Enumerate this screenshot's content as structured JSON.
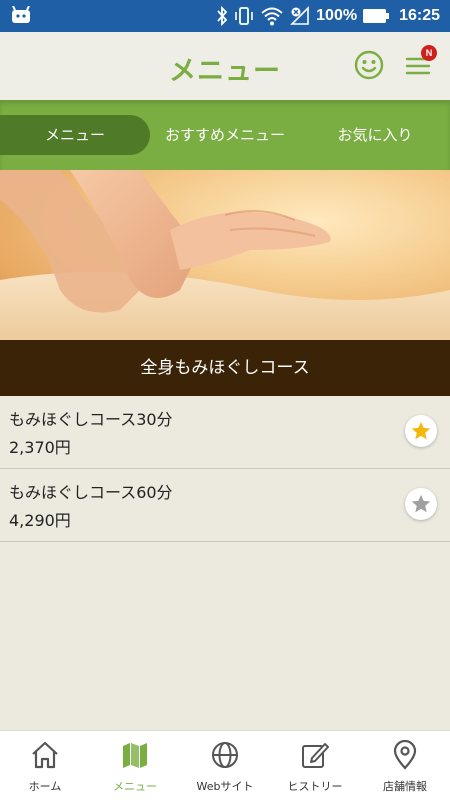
{
  "statusbar": {
    "battery": "100%",
    "time": "16:25"
  },
  "header": {
    "title": "メニュー",
    "badge": "N"
  },
  "tabs": [
    {
      "label": "メニュー",
      "active": true
    },
    {
      "label": "おすすめメニュー",
      "active": false
    },
    {
      "label": "お気に入り",
      "active": false
    }
  ],
  "category": {
    "title": "全身もみほぐしコース"
  },
  "items": [
    {
      "name": "もみほぐしコース30分",
      "price": "2,370円",
      "favorite": true
    },
    {
      "name": "もみほぐしコース60分",
      "price": "4,290円",
      "favorite": false
    }
  ],
  "nav": [
    {
      "label": "ホーム",
      "icon": "home-icon"
    },
    {
      "label": "メニュー",
      "icon": "map-icon",
      "active": true
    },
    {
      "label": "Webサイト",
      "icon": "globe-icon"
    },
    {
      "label": "ヒストリー",
      "icon": "edit-icon"
    },
    {
      "label": "店舗情報",
      "icon": "location-pin-icon"
    }
  ],
  "colors": {
    "accent": "#7AAE42",
    "accent_dark": "#4F7A27",
    "statusbar": "#1F5FA6",
    "category_bar": "#3B2307",
    "background": "#ECEADF",
    "badge": "#D0201C",
    "star_on": "#F2B90C",
    "star_off": "#A0A0A0"
  }
}
